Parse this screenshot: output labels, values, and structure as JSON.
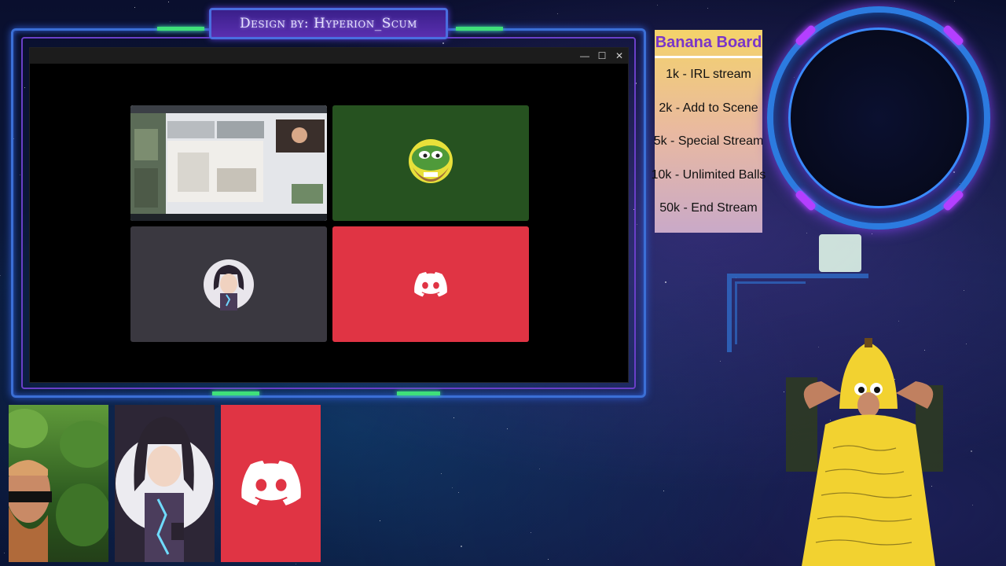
{
  "overlay": {
    "design_credit": "Design by: Hyperion_Scum"
  },
  "window": {
    "minimize_icon": "minimize-icon",
    "maximize_icon": "maximize-icon",
    "close_icon": "close-icon",
    "buttons": {
      "minimize": "—",
      "maximize": "☐",
      "close": "✕"
    }
  },
  "call_grid": {
    "tiles": [
      {
        "type": "screen-share",
        "bg": "#c9ccd2"
      },
      {
        "type": "avatar-frog",
        "bg": "#265220"
      },
      {
        "type": "avatar-anime",
        "bg": "#3a3840"
      },
      {
        "type": "discord-default",
        "bg": "#e03444"
      }
    ]
  },
  "banana_board": {
    "title": "Banana Board",
    "items": [
      "1k - IRL stream",
      "2k - Add to Scene",
      "5k - Special Stream",
      "10k - Unlimited Balls",
      "50k - End Stream"
    ]
  },
  "colors": {
    "discord_red": "#e03444",
    "frame_blue": "#3b6fd6",
    "frame_purple": "#6a3fc8",
    "accent_green": "#3fe07a",
    "board_title": "#7a35c9"
  }
}
